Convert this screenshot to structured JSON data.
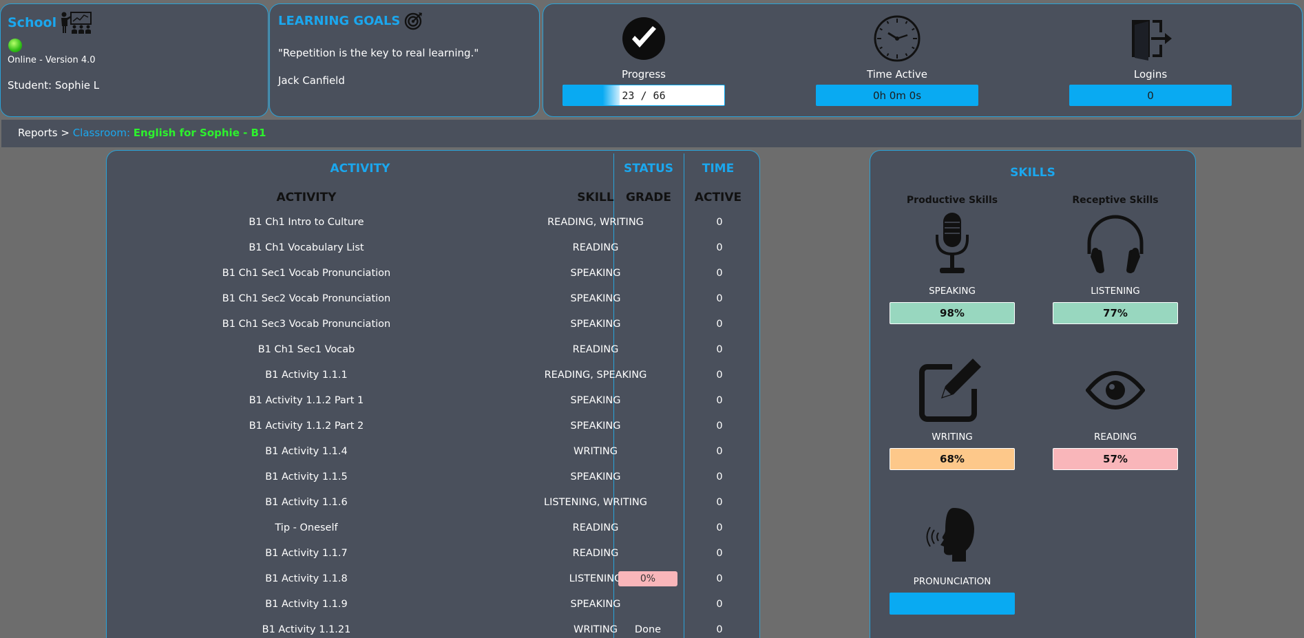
{
  "school": {
    "title": "School",
    "status": "Online - Version 4.0",
    "student": "Student: Sophie L"
  },
  "goals": {
    "title": "LEARNING GOALS",
    "quote": "\"Repetition is the key to real learning.\"",
    "author": "Jack Canfield"
  },
  "stats": {
    "progress": {
      "label": "Progress",
      "value": "23 / 66",
      "fraction": 0.35
    },
    "time": {
      "label": "Time Active",
      "value": "0h 0m 0s"
    },
    "logins": {
      "label": "Logins",
      "value": "0"
    }
  },
  "breadcrumb": {
    "reports": "Reports",
    "separator": ">",
    "classroom_label": "Classroom:",
    "class_name": "English for Sophie - B1"
  },
  "activity": {
    "section_titles": {
      "activity": "ACTIVITY",
      "status": "STATUS",
      "time": "TIME"
    },
    "columns": {
      "activity": "ACTIVITY",
      "skill": "SKILL",
      "grade": "GRADE",
      "active": "ACTIVE"
    },
    "rows": [
      {
        "name": "B1 Ch1 Intro to Culture",
        "skill": "READING, WRITING",
        "grade": "",
        "time": "0"
      },
      {
        "name": "B1 Ch1 Vocabulary List",
        "skill": "READING",
        "grade": "",
        "time": "0"
      },
      {
        "name": "B1 Ch1 Sec1 Vocab Pronunciation",
        "skill": "SPEAKING",
        "grade": "",
        "time": "0"
      },
      {
        "name": "B1 Ch1 Sec2 Vocab Pronunciation",
        "skill": "SPEAKING",
        "grade": "",
        "time": "0"
      },
      {
        "name": "B1 Ch1 Sec3 Vocab Pronunciation",
        "skill": "SPEAKING",
        "grade": "",
        "time": "0"
      },
      {
        "name": "B1 Ch1 Sec1 Vocab",
        "skill": "READING",
        "grade": "",
        "time": "0"
      },
      {
        "name": "B1 Activity 1.1.1",
        "skill": "READING, SPEAKING",
        "grade": "",
        "time": "0"
      },
      {
        "name": "B1 Activity 1.1.2 Part 1",
        "skill": "SPEAKING",
        "grade": "",
        "time": "0"
      },
      {
        "name": "B1 Activity 1.1.2 Part 2",
        "skill": "SPEAKING",
        "grade": "",
        "time": "0"
      },
      {
        "name": "B1 Activity 1.1.4",
        "skill": "WRITING",
        "grade": "",
        "time": "0"
      },
      {
        "name": "B1 Activity 1.1.5",
        "skill": "SPEAKING",
        "grade": "",
        "time": "0"
      },
      {
        "name": "B1 Activity 1.1.6",
        "skill": "LISTENING, WRITING",
        "grade": "",
        "time": "0"
      },
      {
        "name": "Tip - Oneself",
        "skill": "READING",
        "grade": "",
        "time": "0"
      },
      {
        "name": "B1 Activity 1.1.7",
        "skill": "READING",
        "grade": "",
        "time": "0"
      },
      {
        "name": "B1 Activity 1.1.8",
        "skill": "LISTENING",
        "grade": "0%",
        "grade_badge": true,
        "time": "0"
      },
      {
        "name": "B1 Activity 1.1.9",
        "skill": "SPEAKING",
        "grade": "",
        "time": "0"
      },
      {
        "name": "B1 Activity 1.1.21",
        "skill": "WRITING",
        "grade": "Done",
        "time": "0"
      }
    ]
  },
  "skills": {
    "title": "SKILLS",
    "productive_label": "Productive Skills",
    "receptive_label": "Receptive Skills",
    "speaking": {
      "name": "SPEAKING",
      "value": "98%",
      "color": "#98d7bf",
      "icon": "microphone-icon"
    },
    "listening": {
      "name": "LISTENING",
      "value": "77%",
      "color": "#98d7bf",
      "icon": "headphones-icon"
    },
    "writing": {
      "name": "WRITING",
      "value": "68%",
      "color": "#fdc88a",
      "icon": "pencil-square-icon"
    },
    "reading": {
      "name": "READING",
      "value": "57%",
      "color": "#f9b6ba",
      "icon": "eye-icon"
    },
    "pronunciation": {
      "name": "PRONUNCIATION",
      "value": "",
      "color": "#09aaf2",
      "icon": "speaking-head-icon"
    }
  }
}
